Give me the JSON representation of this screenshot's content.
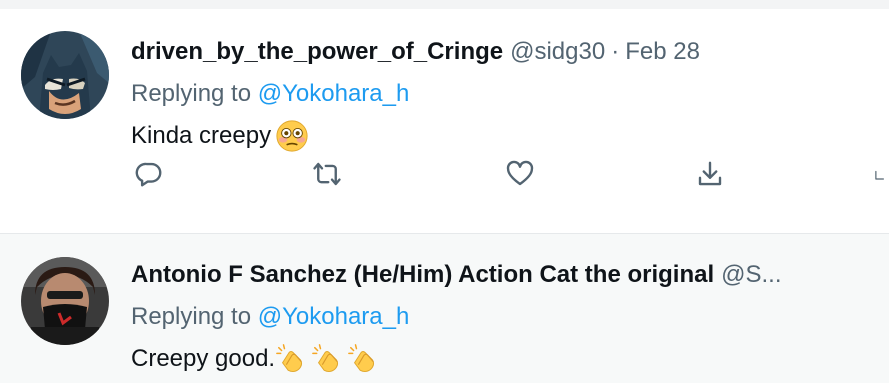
{
  "tweets": [
    {
      "display_name": "driven_by_the_power_of_Cringe",
      "handle": "@sidg30",
      "separator": "·",
      "date": "Feb 28",
      "replying_prefix": "Replying to",
      "replying_to": "@Yokohara_h",
      "text": "Kinda creepy",
      "emoji": [
        "flushed-face"
      ],
      "actions": [
        "reply-icon",
        "retweet-icon",
        "like-icon",
        "share-icon",
        "more-icon"
      ]
    },
    {
      "display_name": "Antonio F Sanchez (He/Him) Action Cat the original",
      "handle": "@S...",
      "replying_prefix": "Replying to",
      "replying_to": "@Yokohara_h",
      "text": "Creepy good.",
      "emoji": [
        "clapping-hands",
        "clapping-hands",
        "clapping-hands"
      ]
    }
  ],
  "colors": {
    "text_primary": "#0f1419",
    "text_secondary": "#536471",
    "link": "#1d9bf0",
    "second_row_background": "#f7f9f9"
  }
}
